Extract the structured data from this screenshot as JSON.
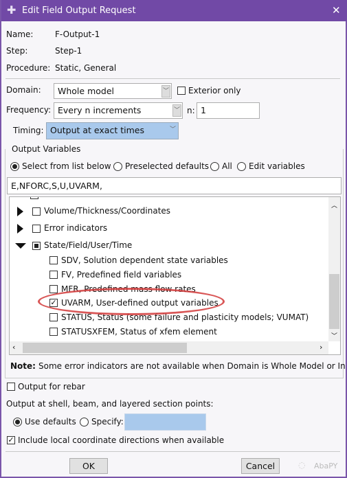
{
  "window": {
    "title": "Edit Field Output Request",
    "close": "✕"
  },
  "info": {
    "name_label": "Name:",
    "name": "F-Output-1",
    "step_label": "Step:",
    "step": "Step-1",
    "procedure_label": "Procedure:",
    "procedure": "Static, General"
  },
  "domain": {
    "label": "Domain:",
    "value": "Whole model",
    "exterior_only": "Exterior only",
    "exterior_checked": false
  },
  "frequency": {
    "label": "Frequency:",
    "value": "Every n increments",
    "n_label": "n:",
    "n": "1"
  },
  "timing": {
    "label": "Timing:",
    "value": "Output at exact times"
  },
  "output_variables": {
    "group_label": "Output Variables",
    "modes": [
      "Select from list below",
      "Preselected defaults",
      "All",
      "Edit variables"
    ],
    "selected_mode": "Select from list below",
    "text": "E,NFORC,S,U,UVARM,",
    "tree": [
      {
        "label": "Volume/Thickness/Coordinates",
        "state": "unchecked",
        "expanded": false
      },
      {
        "label": "Error indicators",
        "state": "unchecked",
        "expanded": false
      },
      {
        "label": "State/Field/User/Time",
        "state": "partial",
        "expanded": true,
        "children": [
          {
            "label": "SDV, Solution dependent state variables",
            "checked": false
          },
          {
            "label": "FV, Predefined field variables",
            "checked": false
          },
          {
            "label": "MFR, Predefined mass flow rates",
            "checked": false
          },
          {
            "label": "UVARM, User-defined output variables",
            "checked": true,
            "highlighted": true
          },
          {
            "label": "STATUS, Status (some failure and plasticity models; VUMAT)",
            "checked": false
          },
          {
            "label": "STATUSXFEM, Status of xfem element",
            "checked": false
          }
        ]
      }
    ],
    "note_label": "Note:",
    "note": "Some error indicators are not available when Domain is Whole Model or Inte"
  },
  "rebar": {
    "label": "Output for rebar",
    "checked": false
  },
  "section_points": {
    "label": "Output at shell, beam, and layered section points:",
    "use_defaults": "Use defaults",
    "specify": "Specify:",
    "specify_value": ""
  },
  "local_coords": {
    "label": "Include local coordinate directions when available",
    "checked": true
  },
  "buttons": {
    "ok": "OK",
    "cancel": "Cancel"
  },
  "watermark": "AbaPY",
  "colors": {
    "title_bar": "#7149a6",
    "selection": "#a9c9ec",
    "highlight_ellipse": "#d23a3a"
  }
}
